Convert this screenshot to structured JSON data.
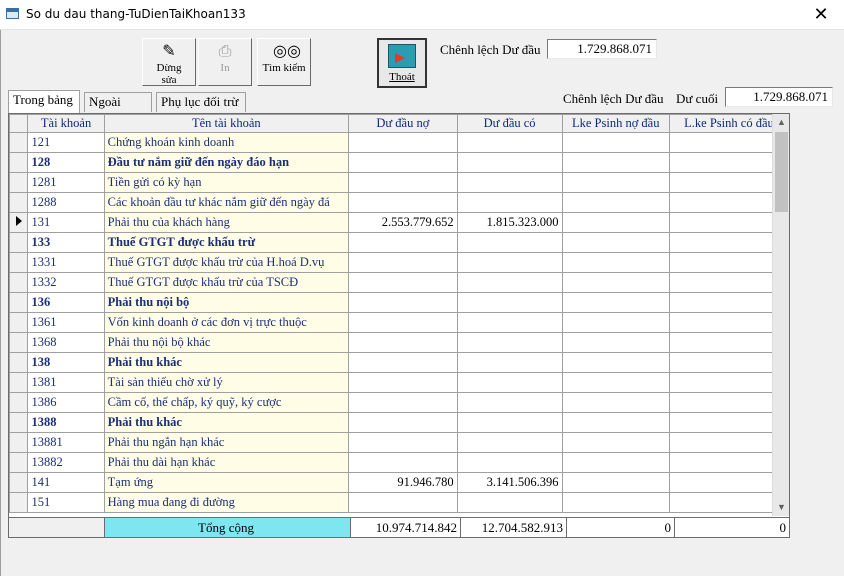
{
  "window": {
    "title": "So du dau thang-TuDienTaiKhoan133",
    "close_glyph": "✕"
  },
  "toolbar": {
    "stop_edit_label": "Dừng sửa",
    "print_label": "In",
    "search_label": "Tìm kiếm",
    "exit_label": "Thoát"
  },
  "diff_opening": {
    "label": "Chênh lệch Dư đầu",
    "value": "1.729.868.071"
  },
  "diff_closing": {
    "label_opening": "Chênh lệch Dư đầu",
    "label_closing": "Dư cuối",
    "value": "1.729.868.071"
  },
  "tabs": [
    "Trong bảng",
    "Ngoài bảng",
    "Phụ lục đối trừ"
  ],
  "columns": [
    "Tài khoản",
    "Tên tài khoản",
    "Dư đầu nợ",
    "Dư đầu có",
    "Lke Psinh nợ đầu",
    "L.ke Psinh có đầu"
  ],
  "rows": [
    {
      "code": "121",
      "name": "Chứng khoán kinh doanh",
      "no": "",
      "co": "",
      "bold": false
    },
    {
      "code": "128",
      "name": "Đầu tư nắm giữ đến ngày đáo hạn",
      "no": "",
      "co": "",
      "bold": true
    },
    {
      "code": "1281",
      "name": "Tiền gửi có kỳ hạn",
      "no": "",
      "co": "",
      "bold": false
    },
    {
      "code": "1288",
      "name": "Các khoản đầu tư khác nắm giữ đến ngày đá",
      "no": "",
      "co": "",
      "bold": false
    },
    {
      "code": "131",
      "name": "Phải thu của khách hàng",
      "no": "2.553.779.652",
      "co": "1.815.323.000",
      "bold": false
    },
    {
      "code": "133",
      "name": "Thuế GTGT được khấu trừ",
      "no": "",
      "co": "",
      "bold": true
    },
    {
      "code": "1331",
      "name": "Thuế GTGT được khấu trừ của H.hoá D.vụ",
      "no": "",
      "co": "",
      "bold": false
    },
    {
      "code": "1332",
      "name": "Thuế GTGT được khấu trừ của TSCĐ",
      "no": "",
      "co": "",
      "bold": false
    },
    {
      "code": "136",
      "name": "Phải thu nội bộ",
      "no": "",
      "co": "",
      "bold": true
    },
    {
      "code": "1361",
      "name": "Vốn kinh doanh ở các đơn vị trực thuộc",
      "no": "",
      "co": "",
      "bold": false
    },
    {
      "code": "1368",
      "name": "Phải thu nội bộ khác",
      "no": "",
      "co": "",
      "bold": false
    },
    {
      "code": "138",
      "name": "Phải thu khác",
      "no": "",
      "co": "",
      "bold": true
    },
    {
      "code": "1381",
      "name": "Tài sản thiếu chờ xử lý",
      "no": "",
      "co": "",
      "bold": false
    },
    {
      "code": "1386",
      "name": "Cầm cố, thế chấp, ký quỹ, ký cược",
      "no": "",
      "co": "",
      "bold": false
    },
    {
      "code": "1388",
      "name": "Phải thu khác",
      "no": "",
      "co": "",
      "bold": true
    },
    {
      "code": "13881",
      "name": "Phải thu ngắn hạn khác",
      "no": "",
      "co": "",
      "bold": false
    },
    {
      "code": "13882",
      "name": "Phải thu dài hạn khác",
      "no": "",
      "co": "",
      "bold": false
    },
    {
      "code": "141",
      "name": "Tạm ứng",
      "no": "91.946.780",
      "co": "3.141.506.396",
      "bold": false
    },
    {
      "code": "151",
      "name": "Hàng mua đang đi đường",
      "no": "",
      "co": "",
      "bold": false
    }
  ],
  "totals": {
    "label": "Tổng cộng",
    "no": "10.974.714.842",
    "co": "12.704.582.913",
    "lke_no": "0",
    "lke_co": "0"
  }
}
